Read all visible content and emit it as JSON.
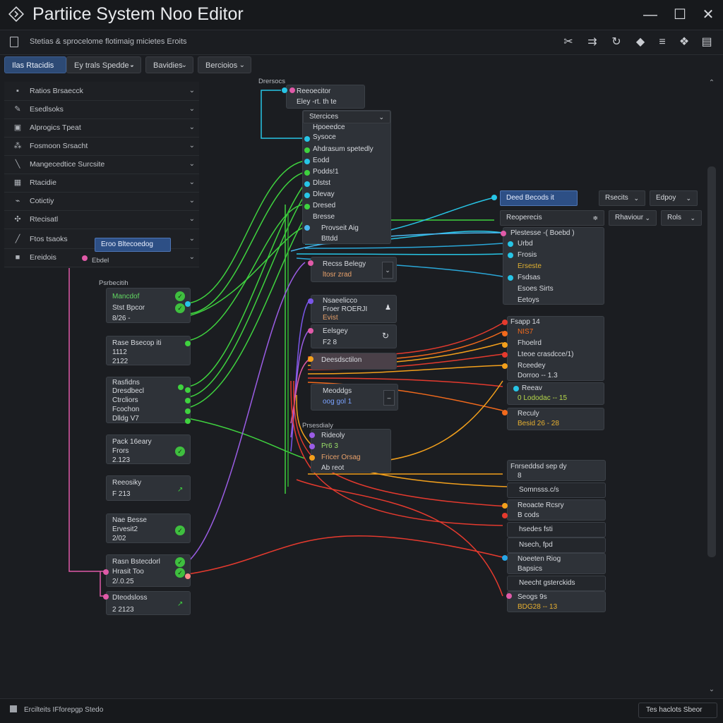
{
  "app": {
    "title": "Partiice System Noo Editor",
    "subtitle": "Stetias & sprocelome flotimaig micietes Eroits"
  },
  "window": {
    "minimize": "—",
    "maximize": "☐",
    "close": "✕"
  },
  "toolbar": {
    "icons": [
      "scissors-icon",
      "arrows-icon",
      "refresh-icon",
      "cube-icon",
      "list-icon",
      "puzzle-icon",
      "layout-icon"
    ],
    "glyphs": [
      "✂",
      "⇉",
      "↻",
      "◆",
      "≡",
      "❖",
      "▤"
    ]
  },
  "tabs": [
    {
      "label": "Ilas Rtacidis",
      "active": true
    },
    {
      "label": "Ey trals Spedde -",
      "active": false
    },
    {
      "label": "Bavidies",
      "active": false
    },
    {
      "label": "Bercioios",
      "active": false
    }
  ],
  "sidebar": {
    "items": [
      {
        "label": "Ratios Brsaecck",
        "glyph": "▪"
      },
      {
        "label": "Esedlsoks",
        "glyph": "✎"
      },
      {
        "label": "Alprogics Tpeat",
        "glyph": "▣"
      },
      {
        "label": "Fosmoon Srsacht",
        "glyph": "⁂"
      },
      {
        "label": "Mangecedtice Surcsite",
        "glyph": "╲"
      },
      {
        "label": "Rtacidie",
        "glyph": "▦"
      },
      {
        "label": "Cotictiy",
        "glyph": "⌁"
      },
      {
        "label": "Rtecisatl",
        "glyph": "✣"
      },
      {
        "label": "Ftos tsaoks",
        "glyph": "╱"
      },
      {
        "label": "Ereidois",
        "glyph": "■"
      }
    ],
    "tooltip": "Eroo Bltecoedog",
    "tooltip_sub": "Ebdel"
  },
  "canvas": {
    "left_caption": "Psrbecitih",
    "mid_caption_top": "Drersocs",
    "mid_caption_low": "Prsesdialy",
    "left_nodes": [
      {
        "lines": [
          "Mancdof",
          "Stst Bpcor",
          "8/26 -"
        ]
      },
      {
        "lines": [
          "Rase Bsecop iti",
          "1112",
          "2122"
        ]
      },
      {
        "lines": [
          "Rasfidns",
          "Dresdbecl",
          "Ctrcliors",
          "Fcochon",
          "Dlldg V7"
        ]
      },
      {
        "lines": [
          "Pack 16eary",
          "Frors",
          "2.123"
        ]
      },
      {
        "lines": [
          "Reeosiky",
          "F 213"
        ]
      },
      {
        "lines": [
          "Nae Besse",
          "Ervesit2",
          "2/02"
        ]
      },
      {
        "lines": [
          "Rasn Bstecdorl",
          "Hrasit Too",
          "2/.0.25"
        ]
      },
      {
        "lines": [
          "Dteodsloss",
          "2 2123"
        ]
      }
    ],
    "middle_top": {
      "title": "Reeoecitor",
      "sub": "Eley -rt. th te"
    },
    "middle_list_header": "Stercices",
    "middle_list": [
      "Hpoeedce",
      "Sysoce",
      "Ahdrasum spetedly",
      "Eodd",
      "Podds!1",
      "Dlstst",
      "Dlevay",
      "Dresed",
      "Bresse",
      "Provseit Aig",
      "Bttdd"
    ],
    "middle_nodes": [
      {
        "lines": [
          "Recss Belegy",
          "ltosr zrad"
        ]
      },
      {
        "lines": [
          "Nsaeelicco",
          "Froer ROERJI",
          "Evist"
        ]
      },
      {
        "lines": [
          "Eelsgey",
          "F2 8"
        ]
      },
      {
        "lines": [
          "Deesdsctilon"
        ]
      },
      {
        "lines": [
          "Meoddgs",
          "oog gol 1"
        ]
      },
      {
        "lines": [
          "Rideoly",
          "Pr6 3",
          "Fricer Orsag",
          "Ab reot"
        ]
      }
    ],
    "right_top": {
      "select": "Deed Becods it",
      "dd1": "Rsecits",
      "dd2": "Edpoy",
      "hdr": "Reoperecis",
      "dd3": "Rhaviour",
      "dd4": "Rols",
      "rows": [
        "Plestesse -( Boebd )",
        "Urbd",
        "Frosis",
        "Erseste",
        "Fsdsas",
        "Esoes Sirts",
        "Eetoys"
      ]
    },
    "right_nodes": [
      {
        "lines": [
          "Fsapp 14",
          "NIS7",
          "Fhoelrd",
          "Lteoe crasdcce/1)",
          "Rceedey",
          "Dorroo -- 1.3"
        ]
      },
      {
        "lines": [
          "Reeav",
          "0 Lododac -- 15"
        ]
      },
      {
        "lines": [
          "Reculy",
          "Besid 26 - 28"
        ]
      },
      {
        "lines": [
          "Fnrseddsd sep dy",
          "8"
        ]
      },
      {
        "lines": [
          "Somnsss.c/s"
        ]
      },
      {
        "lines": [
          "Reoacte Rcsry",
          "B cods"
        ]
      },
      {
        "lines": [
          "hsedes fsti"
        ]
      },
      {
        "lines": [
          "Nsech, fpd"
        ]
      },
      {
        "lines": [
          "Noeeten Riog",
          "Bapsics"
        ]
      },
      {
        "lines": [
          "Neecht gsterckids"
        ]
      },
      {
        "lines": [
          "Seogs 9s",
          "BDG28 -- 13"
        ]
      }
    ]
  },
  "status": {
    "left": "Ercilteits IFforepgp Stedo",
    "right": "Tes haclots Sbeor"
  },
  "colors": {
    "accent": "#2d4a75",
    "green": "#3fcf3f",
    "cyan": "#27c5e6",
    "red": "#e53a2e",
    "orange": "#f3a01c",
    "purple": "#9b5de5",
    "pink": "#e05aa8"
  }
}
